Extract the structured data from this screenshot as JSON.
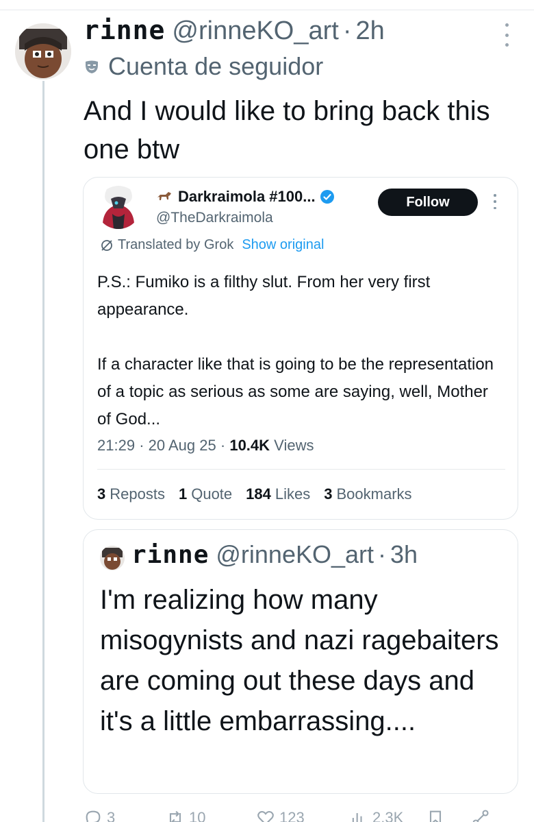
{
  "post": {
    "display_name": "rinne",
    "handle": "@rinneKO_art",
    "separator": "·",
    "time": "2h",
    "account_label": "Cuenta de seguidor",
    "text": "And I would like to bring back this one btw"
  },
  "quoted": {
    "display_name": "Darkraimola #100...",
    "handle": "@TheDarkraimola",
    "follow_label": "Follow",
    "translated_label": "Translated by Grok",
    "show_original_label": "Show original",
    "paragraph_1": "P.S.: Fumiko is a filthy slut. From her very first appearance.",
    "paragraph_2": "If a character like that is going to be the representation of a topic as serious as some are saying, well, Mother of God...",
    "time": "21:29",
    "date": "20 Aug 25",
    "separator": "·",
    "views_count": "10.4K",
    "views_label": "Views",
    "stats": [
      {
        "count": "3",
        "label": "Reposts"
      },
      {
        "count": "1",
        "label": "Quote"
      },
      {
        "count": "184",
        "label": "Likes"
      },
      {
        "count": "3",
        "label": "Bookmarks"
      }
    ]
  },
  "quoted2": {
    "display_name": "rinne",
    "handle": "@rinneKO_art",
    "separator": "·",
    "time": "3h",
    "text": "I'm realizing how many misogynists and nazi ragebaiters are coming out these days and it's a little embarrassing...."
  },
  "actions": [
    {
      "icon": "reply-icon",
      "count": "3"
    },
    {
      "icon": "repost-icon",
      "count": "10"
    },
    {
      "icon": "like-icon",
      "count": "123"
    },
    {
      "icon": "views-icon",
      "count": "2.3K"
    },
    {
      "icon": "bookmark-icon",
      "count": ""
    },
    {
      "icon": "share-icon",
      "count": ""
    }
  ],
  "colors": {
    "text": "#0f1419",
    "secondary": "#536471",
    "link": "#1d9bf0",
    "verified": "#1d9bf0",
    "border": "#e1e6ea"
  }
}
